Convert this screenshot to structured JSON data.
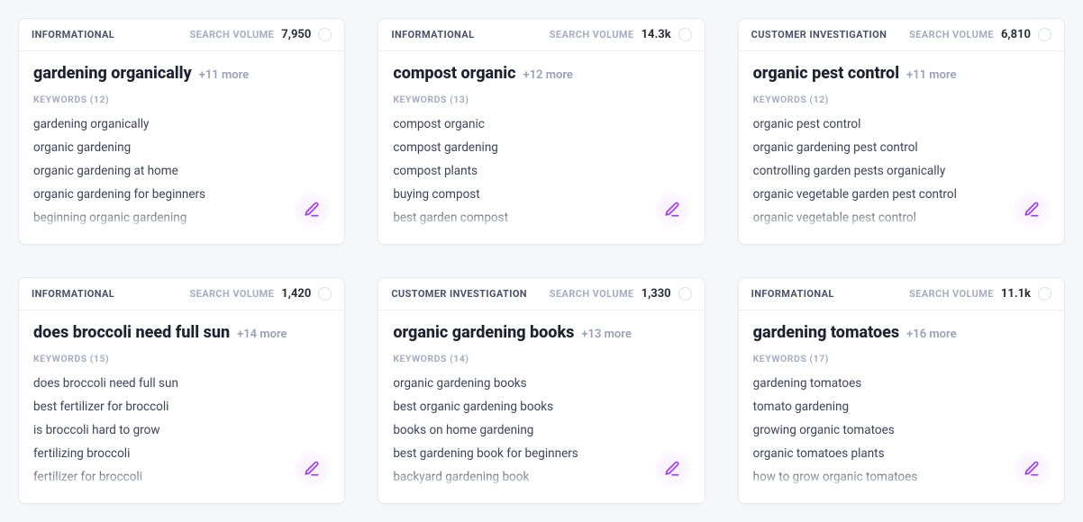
{
  "labels": {
    "search_volume": "SEARCH VOLUME",
    "keywords": "KEYWORDS"
  },
  "cards": [
    {
      "intent": "INFORMATIONAL",
      "volume": "7,950",
      "title": "gardening organically",
      "more": "+11 more",
      "kw_count": "(12)",
      "keywords": [
        "gardening organically",
        "organic gardening",
        "organic gardening at home",
        "organic gardening for beginners",
        "beginning organic gardening"
      ]
    },
    {
      "intent": "INFORMATIONAL",
      "volume": "14.3k",
      "title": "compost organic",
      "more": "+12 more",
      "kw_count": "(13)",
      "keywords": [
        "compost organic",
        "compost gardening",
        "compost plants",
        "buying compost",
        "best garden compost"
      ]
    },
    {
      "intent": "CUSTOMER INVESTIGATION",
      "volume": "6,810",
      "title": "organic pest control",
      "more": "+11 more",
      "kw_count": "(12)",
      "keywords": [
        "organic pest control",
        "organic gardening pest control",
        "controlling garden pests organically",
        "organic vegetable garden pest control",
        "organic vegetable pest control"
      ]
    },
    {
      "intent": "INFORMATIONAL",
      "volume": "1,420",
      "title": "does broccoli need full sun",
      "more": "+14 more",
      "kw_count": "(15)",
      "keywords": [
        "does broccoli need full sun",
        "best fertilizer for broccoli",
        "is broccoli hard to grow",
        "fertilizing broccoli",
        "fertilizer for broccoli"
      ]
    },
    {
      "intent": "CUSTOMER INVESTIGATION",
      "volume": "1,330",
      "title": "organic gardening books",
      "more": "+13 more",
      "kw_count": "(14)",
      "keywords": [
        "organic gardening books",
        "best organic gardening books",
        "books on home gardening",
        "best gardening book for beginners",
        "backyard gardening book"
      ]
    },
    {
      "intent": "INFORMATIONAL",
      "volume": "11.1k",
      "title": "gardening tomatoes",
      "more": "+16 more",
      "kw_count": "(17)",
      "keywords": [
        "gardening tomatoes",
        "tomato gardening",
        "growing organic tomatoes",
        "organic tomatoes plants",
        "how to grow organic tomatoes"
      ]
    }
  ]
}
